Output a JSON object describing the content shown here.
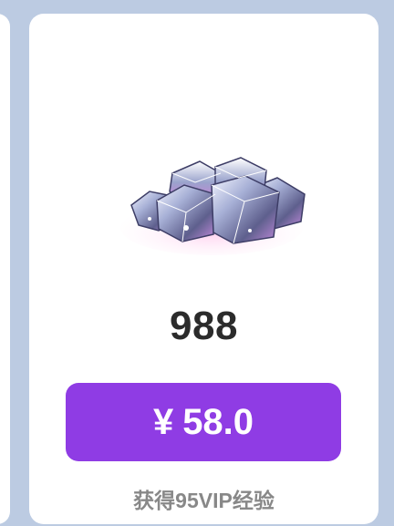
{
  "product": {
    "icon": "diamond-pile-icon",
    "amount": "988",
    "price_symbol": "¥",
    "price_value": "58.0",
    "vip_bonus_text": "获得95VIP经验"
  },
  "colors": {
    "background": "#bccbe2",
    "card": "#ffffff",
    "button": "#8f3ce4",
    "amount_text": "#2b2b2b",
    "vip_text": "#888888"
  }
}
